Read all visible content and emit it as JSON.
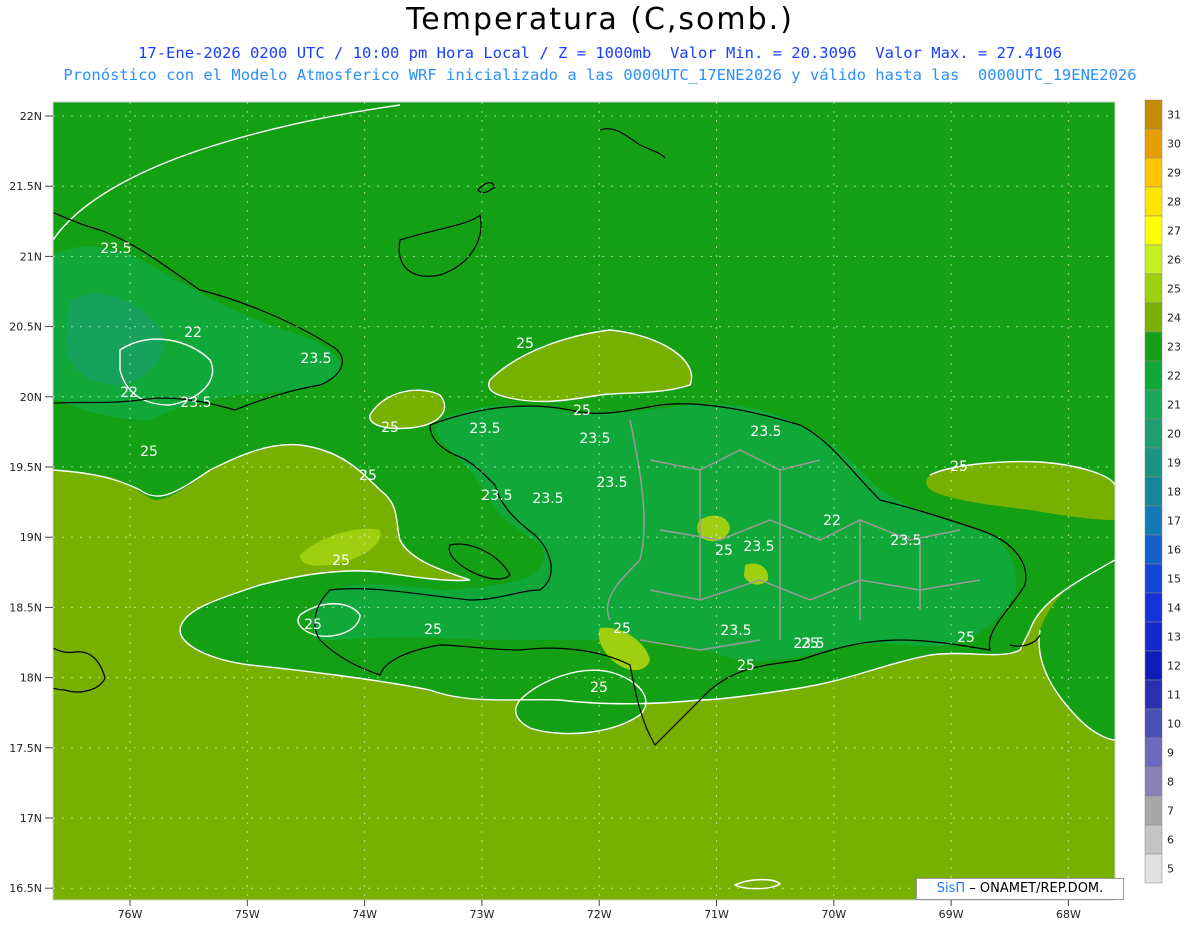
{
  "header": {
    "title": "Temperatura (C,somb.)",
    "line1": "17-Ene-2026 0200 UTC / 10:00 pm Hora Local / Z = 1000mb  Valor Min. = 20.3096  Valor Max. = 27.4106",
    "line2": "Pronóstico con el Modelo Atmosferico WRF inicializado a las 0000UTC_17ENE2026 y válido hasta las  0000UTC_19ENE2026"
  },
  "axes": {
    "lat_labels": [
      "22N",
      "21.5N",
      "21N",
      "20.5N",
      "20N",
      "19.5N",
      "19N",
      "18.5N",
      "18N",
      "17.5N",
      "17N",
      "16.5N"
    ],
    "lon_labels": [
      "76W",
      "75W",
      "74W",
      "73W",
      "72W",
      "71W",
      "70W",
      "69W",
      "68W"
    ]
  },
  "contour_labels": [
    "23.5",
    "22",
    "23.5",
    "22",
    "23.5",
    "25",
    "25",
    "25",
    "25",
    "23.5",
    "23.5",
    "25",
    "23.5",
    "23.5",
    "23.5",
    "23.5",
    "22",
    "25",
    "23.5",
    "23.5",
    "25",
    "25",
    "25",
    "25",
    "25",
    "23.5",
    "23.5",
    "25",
    "25",
    "25",
    "25"
  ],
  "colorbar": {
    "levels": [
      "31",
      "30",
      "29",
      "28",
      "27",
      "26",
      "25",
      "24",
      "23",
      "22",
      "21",
      "20",
      "19",
      "18",
      "17",
      "16",
      "15",
      "14",
      "13",
      "12",
      "11",
      "10",
      "9",
      "8",
      "7",
      "6",
      "5"
    ],
    "colors": [
      "#c88a00",
      "#e69f00",
      "#ffc400",
      "#ffe600",
      "#ffff00",
      "#c8f020",
      "#9ed010",
      "#78b000",
      "#14a014",
      "#10a838",
      "#18a858",
      "#1d9e6e",
      "#199485",
      "#14889a",
      "#1479b4",
      "#1460c8",
      "#1446d4",
      "#1432d8",
      "#1428cc",
      "#101cb8",
      "#2830b0",
      "#4850b8",
      "#6a6ac0",
      "#8a80b8",
      "#a8a8a8",
      "#c4c4c4",
      "#e0e0e0"
    ]
  },
  "credit": {
    "brand": "SisΠ",
    "text": " – ONAMET/REP.DOM."
  }
}
